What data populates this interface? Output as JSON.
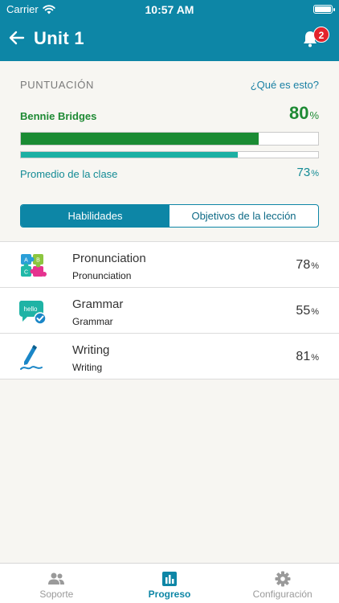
{
  "status_bar": {
    "carrier": "Carrier",
    "time": "10:57 AM"
  },
  "nav": {
    "title": "Unit 1",
    "notification_count": "2"
  },
  "score": {
    "heading": "PUNTUACIÓN",
    "help_link": "¿Qué es esto?",
    "student_name": "Bennie Bridges",
    "student_value": "80",
    "student_fraction": 0.8,
    "percent_sign": "%",
    "class_label": "Promedio de la clase",
    "class_value": "73",
    "class_fraction": 0.73
  },
  "segments": {
    "active": "Habilidades",
    "inactive": "Objetivos de la lección"
  },
  "skills": [
    {
      "name": "Pronunciation",
      "subtitle": "Pronunciation",
      "value": "78",
      "icon": "puzzle-icon"
    },
    {
      "name": "Grammar",
      "subtitle": "Grammar",
      "value": "55",
      "icon": "speech-bubble-icon"
    },
    {
      "name": "Writing",
      "subtitle": "Writing",
      "value": "81",
      "icon": "pen-icon"
    }
  ],
  "speech_icon_text": "hello",
  "tabbar": {
    "support": "Soporte",
    "progress": "Progreso",
    "settings": "Configuración"
  },
  "colors": {
    "primary": "#0d86a6",
    "student_green": "#1a8b33",
    "class_teal": "#1cb0a3",
    "badge_red": "#e3222b"
  }
}
